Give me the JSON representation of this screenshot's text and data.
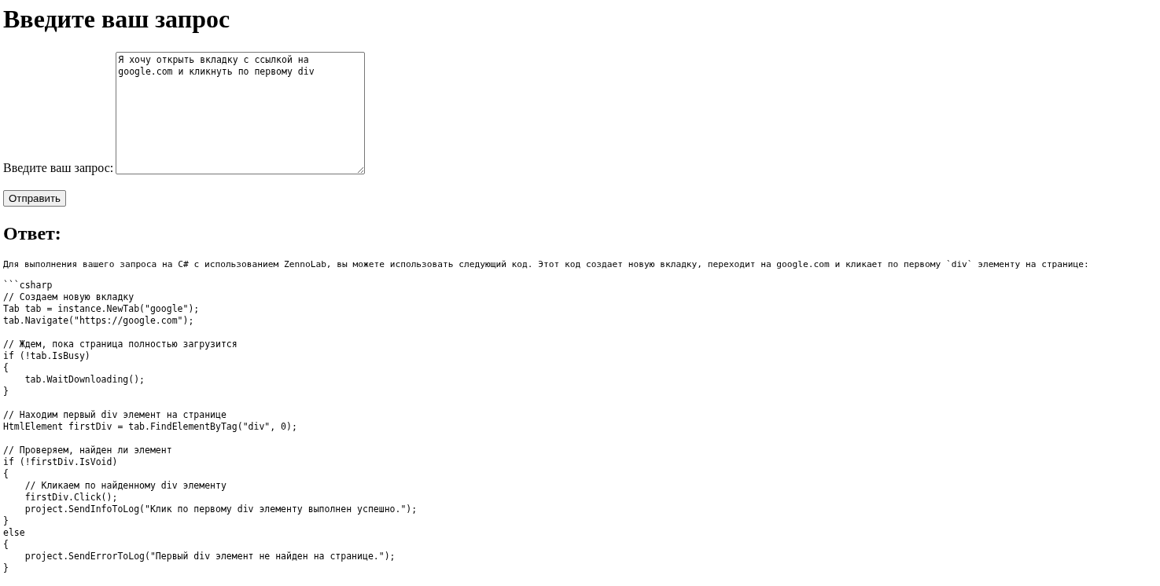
{
  "heading": "Введите ваш запрос",
  "form": {
    "label": "Введите ваш запрос:",
    "value": "Я хочу открыть вкладку с ссылкой на google.com и кликнуть по первому div",
    "button": "Отправить"
  },
  "answer": {
    "heading": "Ответ:",
    "intro": "Для выполнения вашего запроса на C# с использованием ZennoLab, вы можете использовать следующий код. Этот код создает новую вкладку, переходит на google.com и кликает по первому `div` элементу на странице:",
    "code": "```csharp\n// Создаем новую вкладку\nTab tab = instance.NewTab(\"google\");\ntab.Navigate(\"https://google.com\");\n\n// Ждем, пока страница полностью загрузится\nif (!tab.IsBusy)\n{\n    tab.WaitDownloading();\n}\n\n// Находим первый div элемент на странице\nHtmlElement firstDiv = tab.FindElementByTag(\"div\", 0);\n\n// Проверяем, найден ли элемент\nif (!firstDiv.IsVoid)\n{\n    // Кликаем по найденному div элементу\n    firstDiv.Click();\n    project.SendInfoToLog(\"Клик по первому div элементу выполнен успешно.\");\n}\nelse\n{\n    project.SendErrorToLog(\"Первый div элемент не найден на странице.\");\n}"
  }
}
